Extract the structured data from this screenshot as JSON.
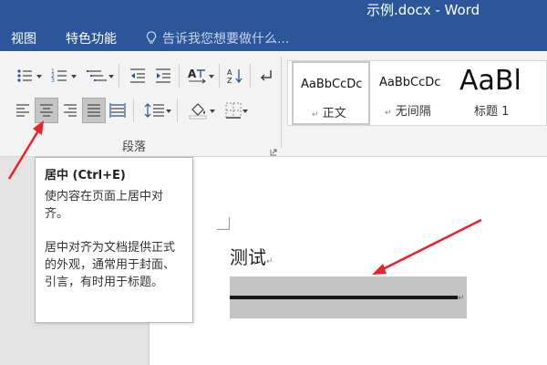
{
  "window": {
    "title": "示例.docx - Word",
    "title_color": "#2b579a"
  },
  "tabs": [
    {
      "label": "视图"
    },
    {
      "label": "特色功能"
    }
  ],
  "tell_me": {
    "placeholder": "告诉我您想要做什么..."
  },
  "ribbon": {
    "paragraph_group": {
      "label": "段落"
    },
    "selected_tool": "align-center"
  },
  "styles": [
    {
      "sample": "AaBbCcDc",
      "name": "正文",
      "selected": true
    },
    {
      "sample": "AaBbCcDc",
      "name": "无间隔",
      "selected": false
    },
    {
      "sample": "AaBl",
      "name": "标题 1",
      "selected": false
    }
  ],
  "tooltip": {
    "title": "居中 (Ctrl+E)",
    "line1": "使内容在页面上居中对齐。",
    "line2": "居中对齐为文档提供正式的外观，通常用于封面、引言，有时用于标题。"
  },
  "document": {
    "heading": "测试",
    "paragraph_mark": "↵"
  },
  "annotation_color": "#e8212a"
}
